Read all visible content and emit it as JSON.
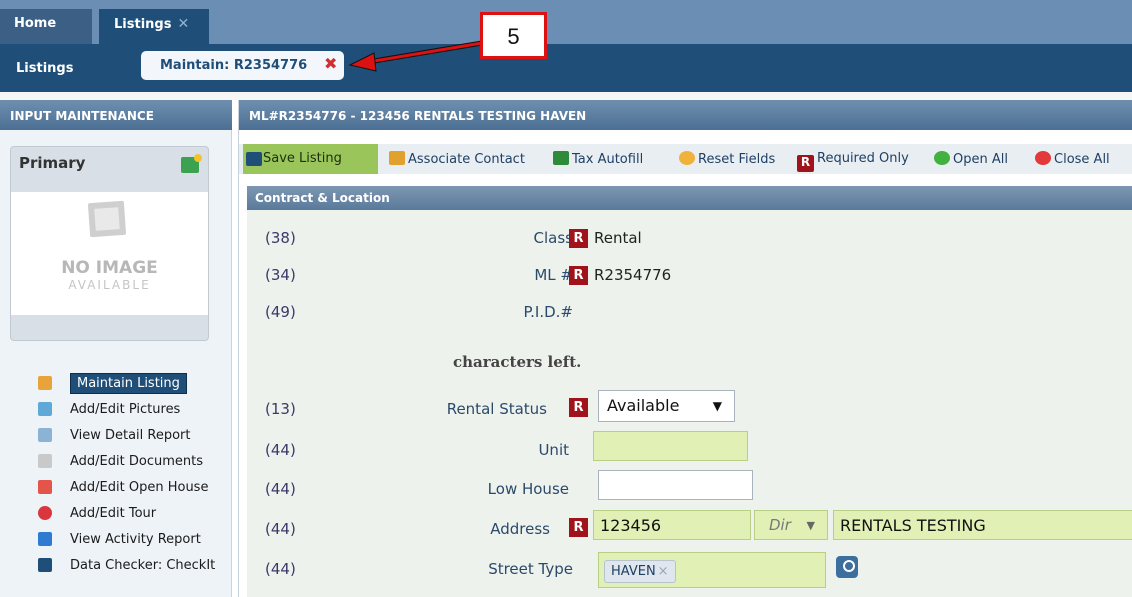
{
  "tabs": {
    "home": "Home",
    "listings": "Listings",
    "listings_close": "✕"
  },
  "subbar": {
    "label": "Listings",
    "maintain_tab": "Maintain: R2354776",
    "maintain_close": "✖"
  },
  "callout": "5",
  "left": {
    "header": "INPUT MAINTENANCE",
    "primary_label": "Primary",
    "no_image_line1": "NO IMAGE",
    "no_image_line2": "AVAILABLE",
    "menu": [
      {
        "label": "Maintain Listing",
        "icon": "pencil-icon",
        "color": "#e8a33a"
      },
      {
        "label": "Add/Edit Pictures",
        "icon": "pictures-icon",
        "color": "#5fa8d8"
      },
      {
        "label": "View Detail Report",
        "icon": "report-icon",
        "color": "#8cb3d6"
      },
      {
        "label": "Add/Edit Documents",
        "icon": "document-icon",
        "color": "#c9c9c9"
      },
      {
        "label": "Add/Edit Open House",
        "icon": "house-icon",
        "color": "#e3544b"
      },
      {
        "label": "Add/Edit Tour",
        "icon": "tour-icon",
        "color": "#d9363e"
      },
      {
        "label": "View Activity Report",
        "icon": "activity-chart-icon",
        "color": "#2f7bd1"
      },
      {
        "label": "Data Checker: CheckIt",
        "icon": "check-icon",
        "color": "#1f4f79"
      }
    ]
  },
  "main": {
    "header": "ML#R2354776 - 123456 RENTALS TESTING HAVEN",
    "toolbar": {
      "save": "Save Listing",
      "associate": "Associate Contact",
      "tax": "Tax Autofill",
      "reset": "Reset Fields",
      "required": "Required Only",
      "required_badge": "R",
      "open_all": "Open All",
      "close_all": "Close All"
    },
    "section": "Contract & Location",
    "rows": {
      "class": {
        "num": "(38)",
        "label": "Class",
        "value": "Rental"
      },
      "ml": {
        "num": "(34)",
        "label": "ML #",
        "value": "R2354776"
      },
      "pid": {
        "num": "(49)",
        "label": "P.I.D.#"
      },
      "chars": "characters left.",
      "status": {
        "num": "(13)",
        "label": "Rental Status",
        "value": "Available"
      },
      "unit": {
        "num": "(44)",
        "label": "Unit",
        "value": ""
      },
      "low_house": {
        "num": "(44)",
        "label": "Low House",
        "value": ""
      },
      "address": {
        "num": "(44)",
        "label": "Address",
        "number": "123456",
        "dir_placeholder": "Dir",
        "street": "RENTALS TESTING"
      },
      "street_type": {
        "num": "(44)",
        "label": "Street Type",
        "chip": "HAVEN",
        "chip_x": "×"
      }
    },
    "required_badge": "R"
  }
}
